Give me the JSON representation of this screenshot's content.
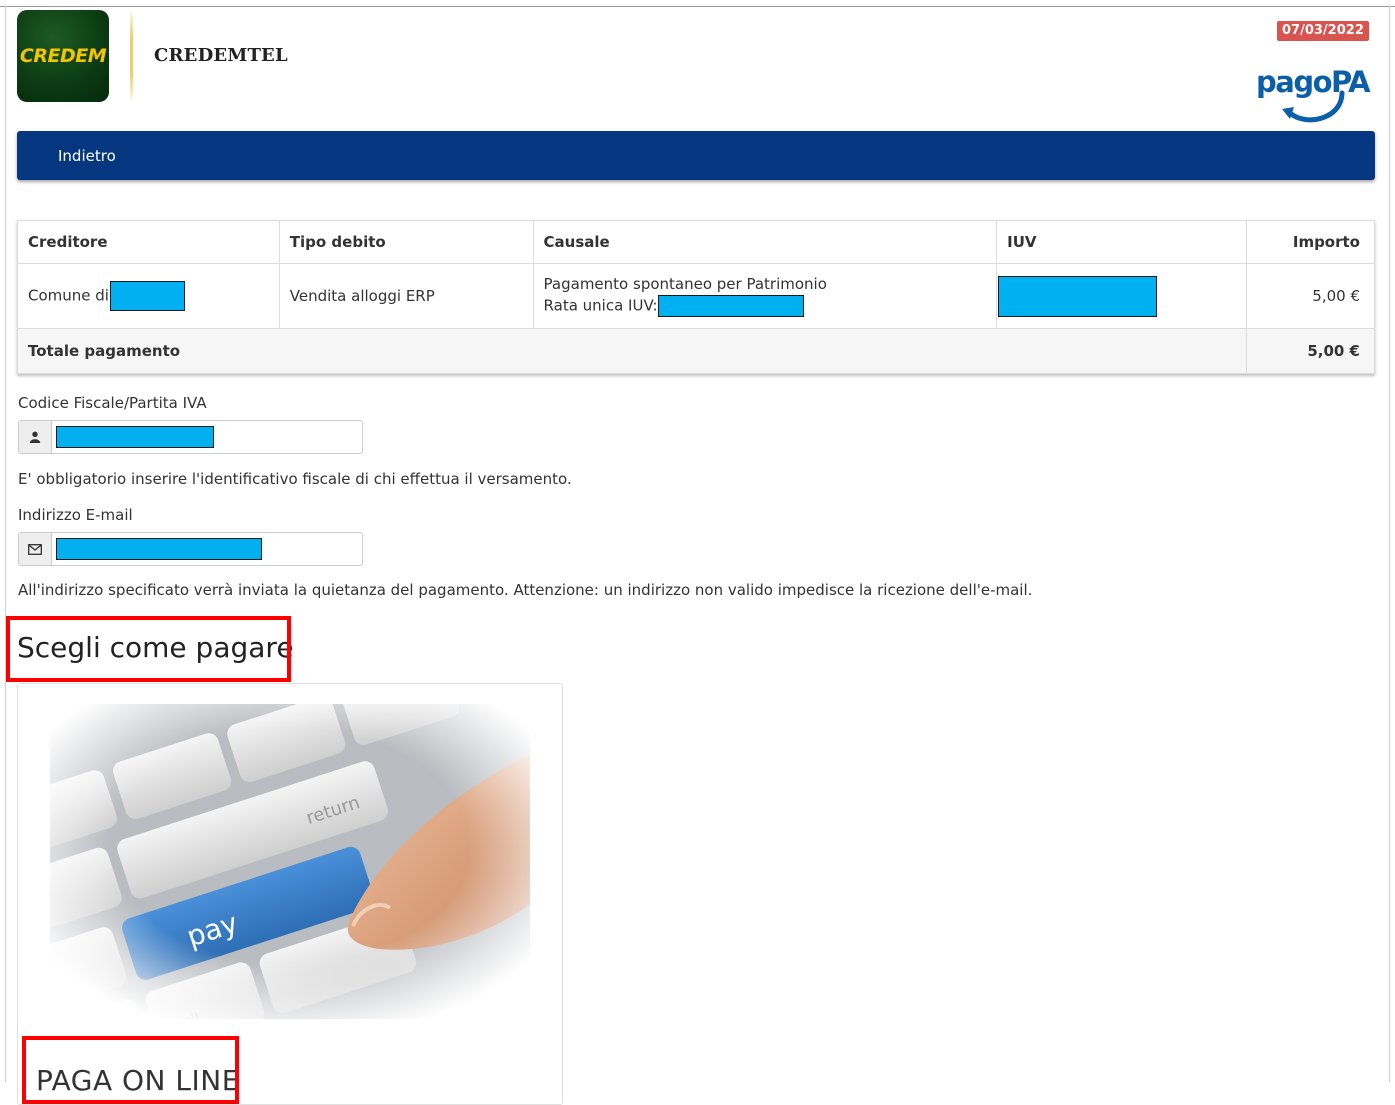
{
  "header": {
    "logo_text": "CREDEM",
    "brand_name": "CREDEMTEL",
    "date": "07/03/2022",
    "pagopa_text": "pagoPA"
  },
  "nav": {
    "back_label": "Indietro"
  },
  "table": {
    "columns": [
      "Creditore",
      "Tipo debito",
      "Causale",
      "IUV",
      "Importo"
    ],
    "row": {
      "creditore": "Comune di",
      "tipo_debito": "Vendita alloggi ERP",
      "causale_line1": "Pagamento spontaneo per Patrimonio",
      "causale_line2": "Rata unica IUV:",
      "importo": "5,00 €"
    },
    "total_label": "Totale pagamento",
    "total_value": "5,00 €"
  },
  "form": {
    "fiscal_label": "Codice Fiscale/Partita IVA",
    "fiscal_help": "E' obbligatorio inserire l'identificativo fiscale di chi effettua il versamento.",
    "email_label": "Indirizzo E-mail",
    "email_help": "All'indirizzo specificato verrà inviata la quietanza del pagamento. Attenzione: un indirizzo non valido impedisce la ricezione dell'e-mail."
  },
  "payment": {
    "section_title": "Scegli come pagare",
    "card_title": "PAGA ON LINE",
    "key_return": "return",
    "key_pay": "pay",
    "key_alt": "alt"
  },
  "colors": {
    "navbar": "#053780",
    "badge": "#d9534f",
    "redaction": "#00b0f0",
    "highlight": "#ff0000"
  },
  "icons": {
    "fiscal": "user-icon",
    "email": "envelope-icon"
  }
}
